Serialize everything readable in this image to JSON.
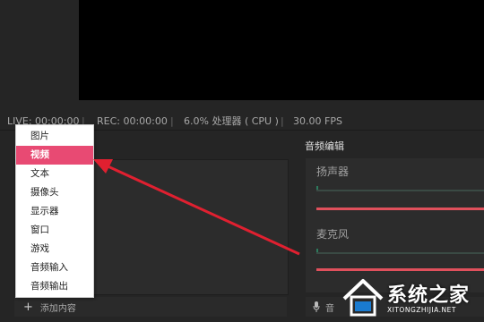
{
  "status": {
    "live": "LIVE: 00:00:00",
    "rec": "REC: 00:00:00",
    "cpu": "6.0% 处理器 ( CPU )",
    "fps": "30.00 FPS"
  },
  "menu": {
    "items": [
      {
        "label": "图片",
        "active": false
      },
      {
        "label": "视频",
        "active": true
      },
      {
        "label": "文本",
        "active": false
      },
      {
        "label": "摄像头",
        "active": false
      },
      {
        "label": "显示器",
        "active": false
      },
      {
        "label": "窗口",
        "active": false
      },
      {
        "label": "游戏",
        "active": false
      },
      {
        "label": "音频输入",
        "active": false
      },
      {
        "label": "音频输出",
        "active": false
      }
    ]
  },
  "sources": {
    "add_label": "添加内容"
  },
  "audio": {
    "title": "音频编辑",
    "speaker_label": "扬声器",
    "mic_label": "麦克风",
    "mic_bar_label": "音"
  },
  "watermark": {
    "name": "系统之家",
    "url": "XITONGZHIJIA.NET"
  },
  "colors": {
    "accent": "#e84a73",
    "volume": "#e0505c",
    "arrow": "#e02030"
  }
}
